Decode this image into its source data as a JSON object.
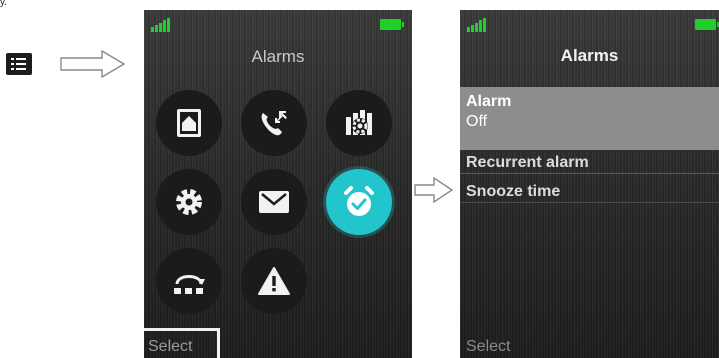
{
  "caption": "y.",
  "left_screen": {
    "title": "Alarms",
    "softkey": "Select",
    "menu_icons": [
      {
        "name": "contacts-icon"
      },
      {
        "name": "call-list-icon"
      },
      {
        "name": "settings-panel-icon"
      },
      {
        "name": "settings-icon"
      },
      {
        "name": "messages-icon"
      },
      {
        "name": "alarm-clock-icon",
        "selected": true
      },
      {
        "name": "connections-icon"
      },
      {
        "name": "alert-icon"
      }
    ],
    "accent_color": "#22c5cc"
  },
  "right_screen": {
    "title": "Alarms",
    "softkey": "Select",
    "items": [
      {
        "label": "Alarm",
        "value": "Off"
      },
      {
        "label": "Recurrent alarm"
      },
      {
        "label": "Snooze time"
      }
    ]
  },
  "colors": {
    "battery": "#1fcf2a",
    "signal": "#1fcf2a",
    "selected_row": "#8d8d8d"
  }
}
